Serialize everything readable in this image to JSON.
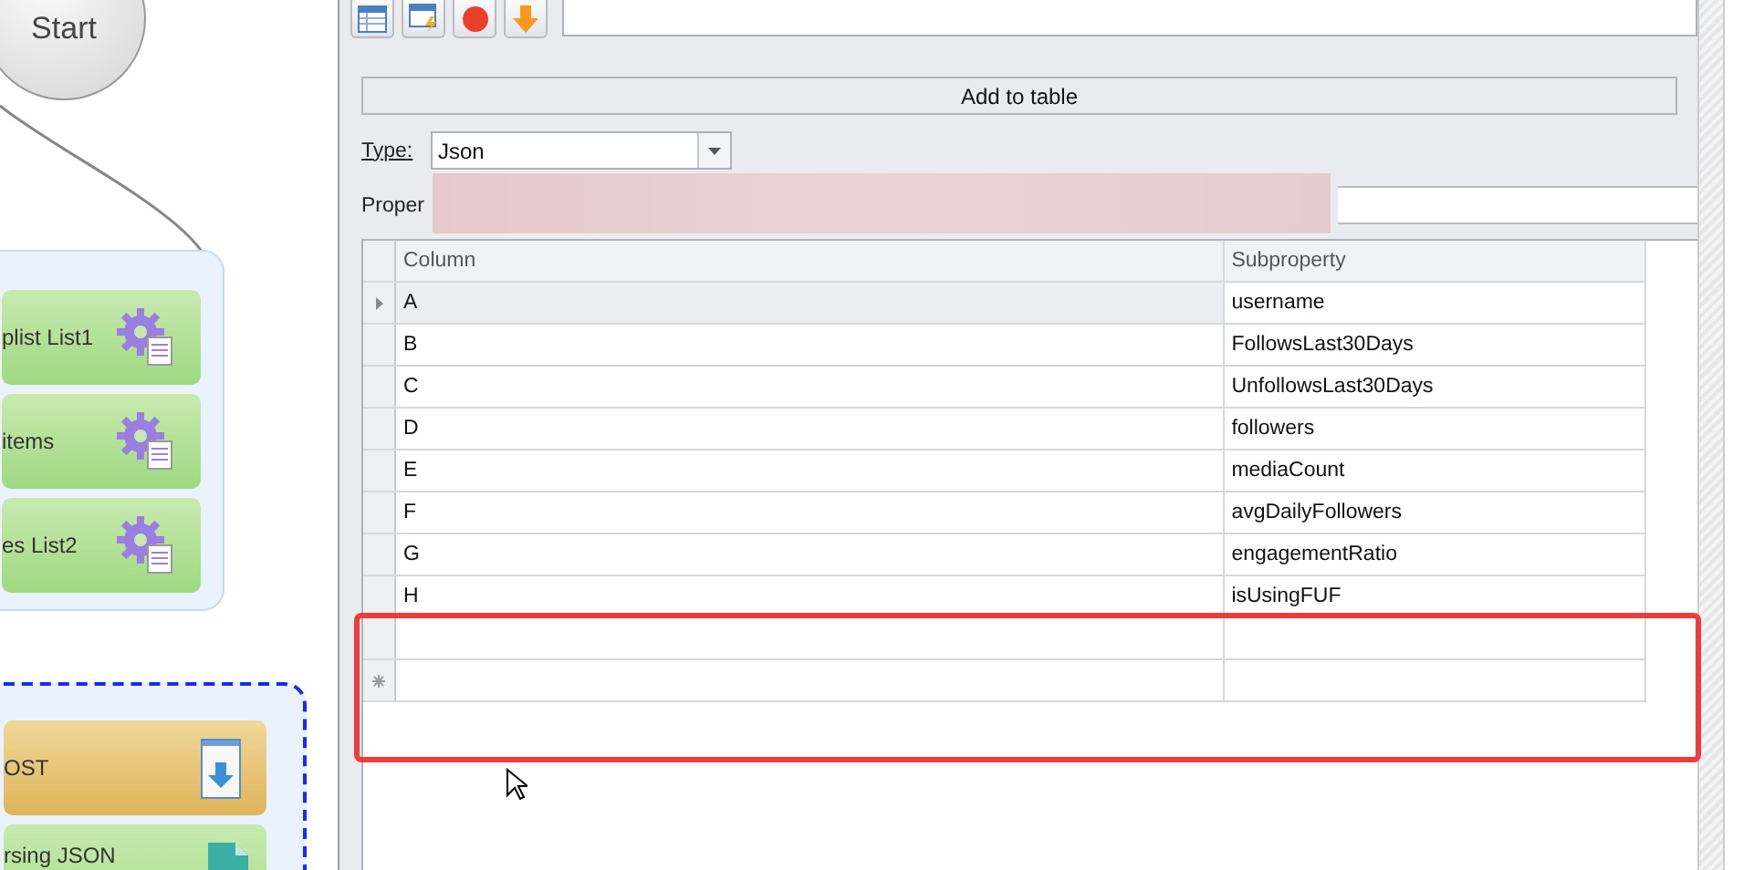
{
  "canvas": {
    "start": "Start",
    "groups": [
      {
        "kind": "solid",
        "nodes": [
          {
            "label": "plist List1",
            "kind": "gear"
          },
          {
            "label": "items",
            "kind": "gear"
          },
          {
            "label": "es List2",
            "kind": "gear"
          }
        ]
      },
      {
        "kind": "dashed",
        "nodes": [
          {
            "label": "OST",
            "kind": "download"
          },
          {
            "label": "rsing JSON",
            "kind": "document"
          }
        ]
      }
    ]
  },
  "toolbar": {
    "buttons": [
      {
        "kind": "table"
      },
      {
        "kind": "window"
      },
      {
        "kind": "stop"
      },
      {
        "kind": "down"
      }
    ]
  },
  "add_button": "Add to table",
  "type_field": {
    "label": "Type:",
    "value": "Json"
  },
  "property_label": "Proper",
  "table": {
    "columns": [
      "Column",
      "Subproperty"
    ],
    "rows": [
      {
        "kind": "data",
        "column": "A",
        "subproperty": "username",
        "selected": true
      },
      {
        "kind": "data",
        "column": "B",
        "subproperty": "FollowsLast30Days",
        "selected": false
      },
      {
        "kind": "data",
        "column": "C",
        "subproperty": "UnfollowsLast30Days",
        "selected": false
      },
      {
        "kind": "data",
        "column": "D",
        "subproperty": "followers",
        "selected": false
      },
      {
        "kind": "data",
        "column": "E",
        "subproperty": "mediaCount",
        "selected": false
      },
      {
        "kind": "data",
        "column": "F",
        "subproperty": "avgDailyFollowers",
        "selected": false
      },
      {
        "kind": "data",
        "column": "G",
        "subproperty": "engagementRatio",
        "selected": false
      },
      {
        "kind": "data",
        "column": "H",
        "subproperty": "isUsingFUF",
        "selected": false
      },
      {
        "kind": "empty",
        "selected": false
      },
      {
        "kind": "new",
        "selected": false
      }
    ]
  }
}
